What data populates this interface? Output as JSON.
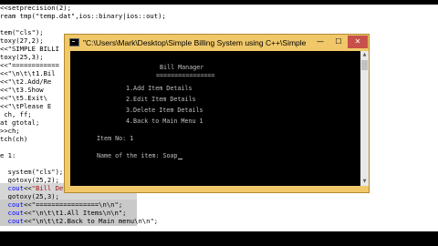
{
  "editor": {
    "lines": [
      {
        "segments": [
          {
            "t": "<<setprecision(2);"
          }
        ]
      },
      {
        "segments": [
          {
            "t": "ream tmp(\"temp.dat\",ios::binary|ios::out);"
          }
        ]
      },
      {
        "segments": [
          {
            "t": ""
          }
        ]
      },
      {
        "segments": [
          {
            "t": "tem(\"cls\");"
          }
        ]
      },
      {
        "segments": [
          {
            "t": "toxy(27,2);"
          }
        ]
      },
      {
        "segments": [
          {
            "t": "<<\"SIMPLE BILLI"
          }
        ]
      },
      {
        "segments": [
          {
            "t": "toxy(25,3);"
          }
        ]
      },
      {
        "segments": [
          {
            "t": "<<\"============"
          }
        ]
      },
      {
        "segments": [
          {
            "t": "<<\"\\n\\t\\t1.Bil"
          }
        ]
      },
      {
        "segments": [
          {
            "t": "<<\"\\t2.Add/Re"
          }
        ]
      },
      {
        "segments": [
          {
            "t": "<<\"\\t3.Show"
          }
        ]
      },
      {
        "segments": [
          {
            "t": "<<\"\\t5.Exit\\"
          }
        ]
      },
      {
        "segments": [
          {
            "t": "<<\"\\tPlease E"
          }
        ]
      },
      {
        "segments": [
          {
            "t": " ch, ff;"
          }
        ]
      },
      {
        "segments": [
          {
            "t": "at gtotal;"
          }
        ]
      },
      {
        "segments": [
          {
            "t": ">>ch;"
          }
        ]
      },
      {
        "segments": [
          {
            "t": "tch(ch)"
          }
        ]
      },
      {
        "segments": [
          {
            "t": ""
          }
        ]
      },
      {
        "segments": [
          {
            "t": "e 1:"
          }
        ]
      },
      {
        "segments": [
          {
            "t": ""
          }
        ]
      },
      {
        "segments": [
          {
            "t": "  system(\"cls\");"
          }
        ]
      },
      {
        "segments": [
          {
            "t": "  gotoxy(25,2);"
          }
        ]
      },
      {
        "segments": [
          {
            "t": "  "
          },
          {
            "t": "cout",
            "k": "kw"
          },
          {
            "t": "<<"
          },
          {
            "t": "\"Bill Details\"",
            "k": "str"
          },
          {
            "t": ";"
          }
        ]
      },
      {
        "segments": [
          {
            "t": "  gotoxy(25,3);"
          }
        ]
      },
      {
        "segments": [
          {
            "t": "  "
          },
          {
            "t": "cout",
            "k": "kw"
          },
          {
            "t": "<<\"================\\n\\n\";"
          }
        ]
      },
      {
        "segments": [
          {
            "t": "  "
          },
          {
            "t": "cout",
            "k": "kw"
          },
          {
            "t": "<<\"\\n\\t\\t1.All Items\\n\\n\";"
          }
        ]
      },
      {
        "segments": [
          {
            "t": "  "
          },
          {
            "t": "cout",
            "k": "kw"
          },
          {
            "t": "<<\"\\n\\t\\t2.Back to Main menu\\n\\n\";"
          }
        ]
      }
    ]
  },
  "console_window": {
    "title": "\"C:\\Users\\Mark\\Desktop\\Simple Billing System using C++\\Simple Billing Syste...",
    "controls": {
      "minimize": "—",
      "maximize": "☐",
      "close": "✕"
    },
    "output_lines": [
      "Bill Manager",
      "================",
      "1.Add Item Details",
      "2.Edit Item Details",
      "3.Delete Item Details",
      "4.Back to Main Menu 1",
      "Item No: 1",
      "Name of the item: Soap"
    ],
    "scrollbar": {
      "up": "▲",
      "down": "▼"
    }
  }
}
